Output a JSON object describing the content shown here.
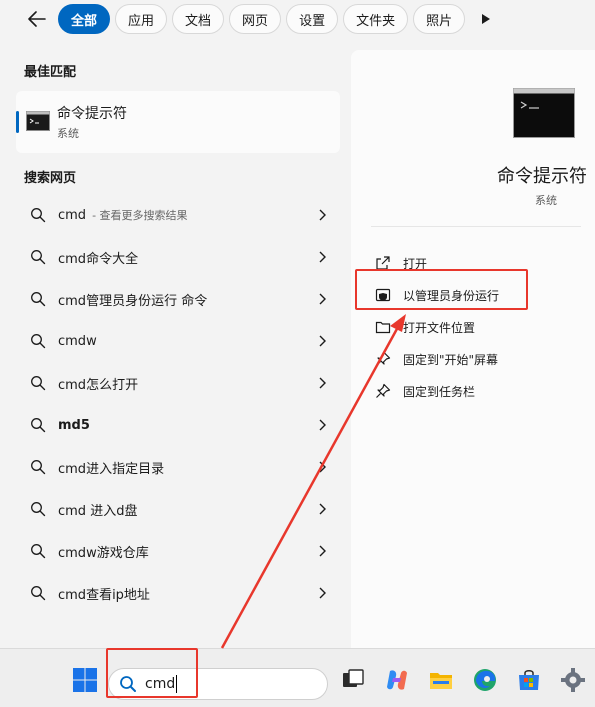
{
  "filters": {
    "back_label": "",
    "chips": [
      "全部",
      "应用",
      "文档",
      "网页",
      "设置",
      "文件夹",
      "照片"
    ]
  },
  "best_match": {
    "section_title": "最佳匹配",
    "name": "命令提示符",
    "type": "系统"
  },
  "web": {
    "section_title": "搜索网页",
    "items": [
      {
        "text": "cmd",
        "sub": "- 查看更多搜索结果",
        "bold": false
      },
      {
        "text": "cmd命令大全",
        "sub": "",
        "bold": false
      },
      {
        "text": "cmd管理员身份运行 命令",
        "sub": "",
        "bold": false
      },
      {
        "text": "cmdw",
        "sub": "",
        "bold": false
      },
      {
        "text": "cmd怎么打开",
        "sub": "",
        "bold": false
      },
      {
        "text": "md5",
        "sub": "",
        "bold": true
      },
      {
        "text": "cmd进入指定目录",
        "sub": "",
        "bold": false
      },
      {
        "text": "cmd 进入d盘",
        "sub": "",
        "bold": false
      },
      {
        "text": "cmdw游戏仓库",
        "sub": "",
        "bold": false
      },
      {
        "text": "cmd查看ip地址",
        "sub": "",
        "bold": false
      }
    ]
  },
  "preview": {
    "name": "命令提示符",
    "type": "系统",
    "actions": [
      {
        "label": "打开",
        "icon": "open-external-icon"
      },
      {
        "label": "以管理员身份运行",
        "icon": "shield-icon"
      },
      {
        "label": "打开文件位置",
        "icon": "folder-icon"
      },
      {
        "label": "固定到\"开始\"屏幕",
        "icon": "pin-icon"
      },
      {
        "label": "固定到任务栏",
        "icon": "pin-icon"
      }
    ]
  },
  "taskbar": {
    "search_value": "cmd",
    "icons": [
      "windows-start-icon",
      "task-view-icon",
      "copilot-icon",
      "file-explorer-icon",
      "edge-icon",
      "store-icon",
      "settings-icon"
    ]
  },
  "colors": {
    "accent": "#0067c0",
    "annotation": "#e8372c"
  }
}
